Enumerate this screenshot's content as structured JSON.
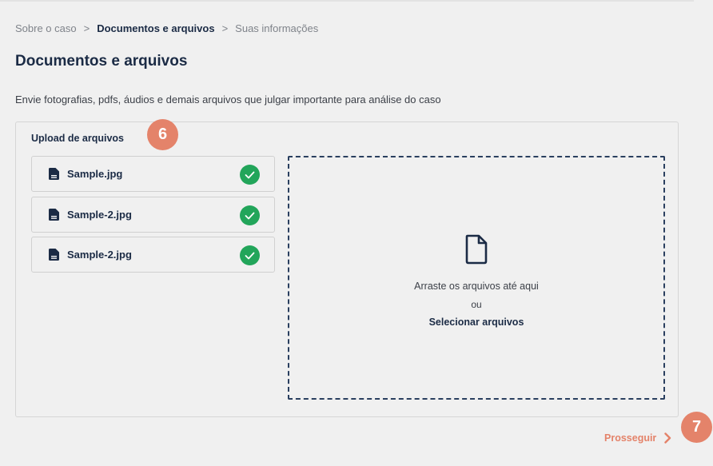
{
  "breadcrumb": {
    "items": [
      "Sobre o caso",
      "Documentos e arquivos",
      "Suas informações"
    ],
    "separator": ">"
  },
  "page": {
    "title": "Documentos e arquivos",
    "description": "Envie fotografias, pdfs, áudios e demais arquivos que julgar importante para análise do caso"
  },
  "upload": {
    "title": "Upload de arquivos",
    "files": [
      {
        "name": "Sample.jpg",
        "status": "uploaded"
      },
      {
        "name": "Sample-2.jpg",
        "status": "uploaded"
      },
      {
        "name": "Sample-2.jpg",
        "status": "uploaded"
      }
    ],
    "dropzone": {
      "drag_text": "Arraste os arquivos até aqui",
      "or_text": "ou",
      "select_label": "Selecionar arquivos"
    }
  },
  "annotations": {
    "badge_a": "6",
    "badge_b": "7"
  },
  "footer": {
    "next_label": "Prosseguir"
  },
  "colors": {
    "primary": "#1b2b45",
    "accent": "#e4836a",
    "success": "#22a55a",
    "background": "#f0f0f0"
  },
  "icons": {
    "file": "document-icon",
    "success": "check-circle-icon",
    "upload": "document-outline-icon",
    "next": "chevron-right-icon"
  }
}
